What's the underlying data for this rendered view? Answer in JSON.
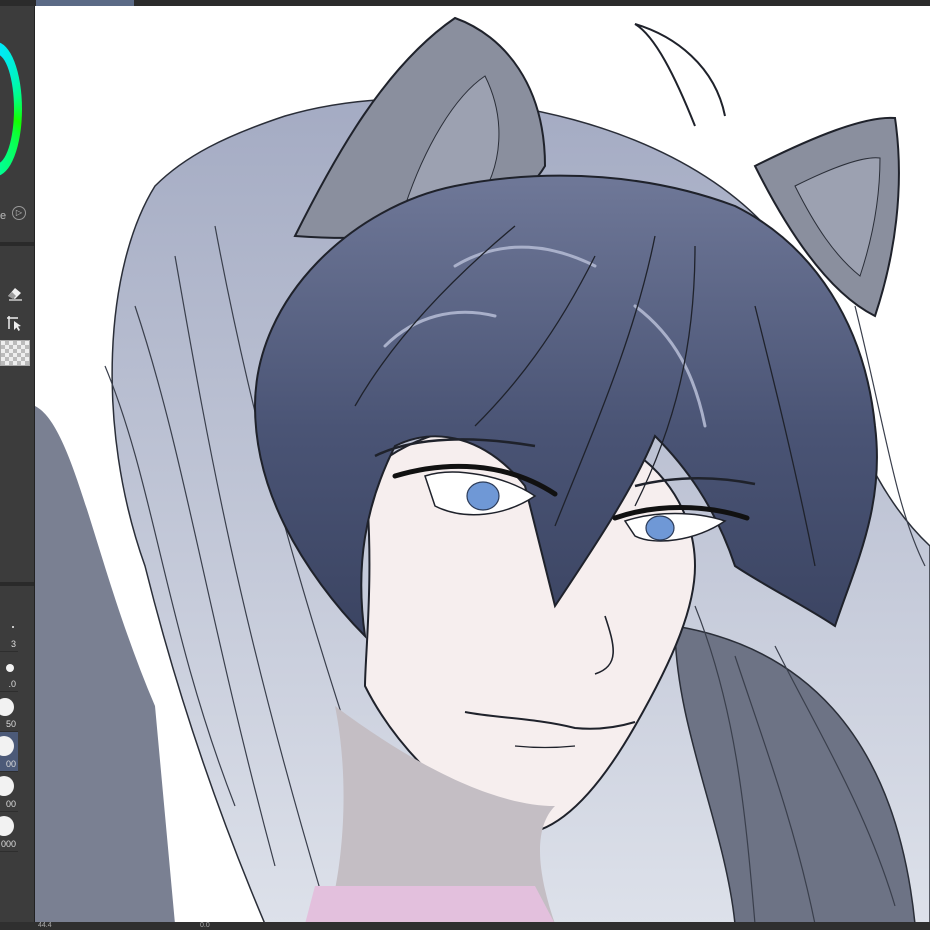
{
  "window": {
    "doc_tab_label": ""
  },
  "left_panel": {
    "color_wheel_mode_label": "e",
    "color_wheel_toggle_glyph": "▷",
    "tools": [
      {
        "name": "eraser-icon",
        "glyph": "◆"
      },
      {
        "name": "transform-select-icon",
        "glyph": "↖"
      }
    ],
    "brush_sizes": [
      {
        "label": "3",
        "dot": 2,
        "selected": false
      },
      {
        "label": ".0",
        "dot": 8,
        "selected": false
      },
      {
        "label": "50",
        "dot": 18,
        "selected": false
      },
      {
        "label": "00",
        "dot": 20,
        "selected": true
      },
      {
        "label": "00",
        "dot": 20,
        "selected": false
      },
      {
        "label": "000",
        "dot": 20,
        "selected": false
      }
    ]
  },
  "status_bar": {
    "zoom": "44.4",
    "angle": "0.0"
  },
  "colors": {
    "hair_dark": "#3e4866",
    "hair_mid": "#7c86a8",
    "hair_light": "#c4c9db",
    "ear": "#8a8f9e",
    "skin": "#f6eeee",
    "eye": "#6f98d6",
    "neck_shadow": "#c4bec4",
    "shirt": "#e3c0dd",
    "line": "#1f222b"
  }
}
